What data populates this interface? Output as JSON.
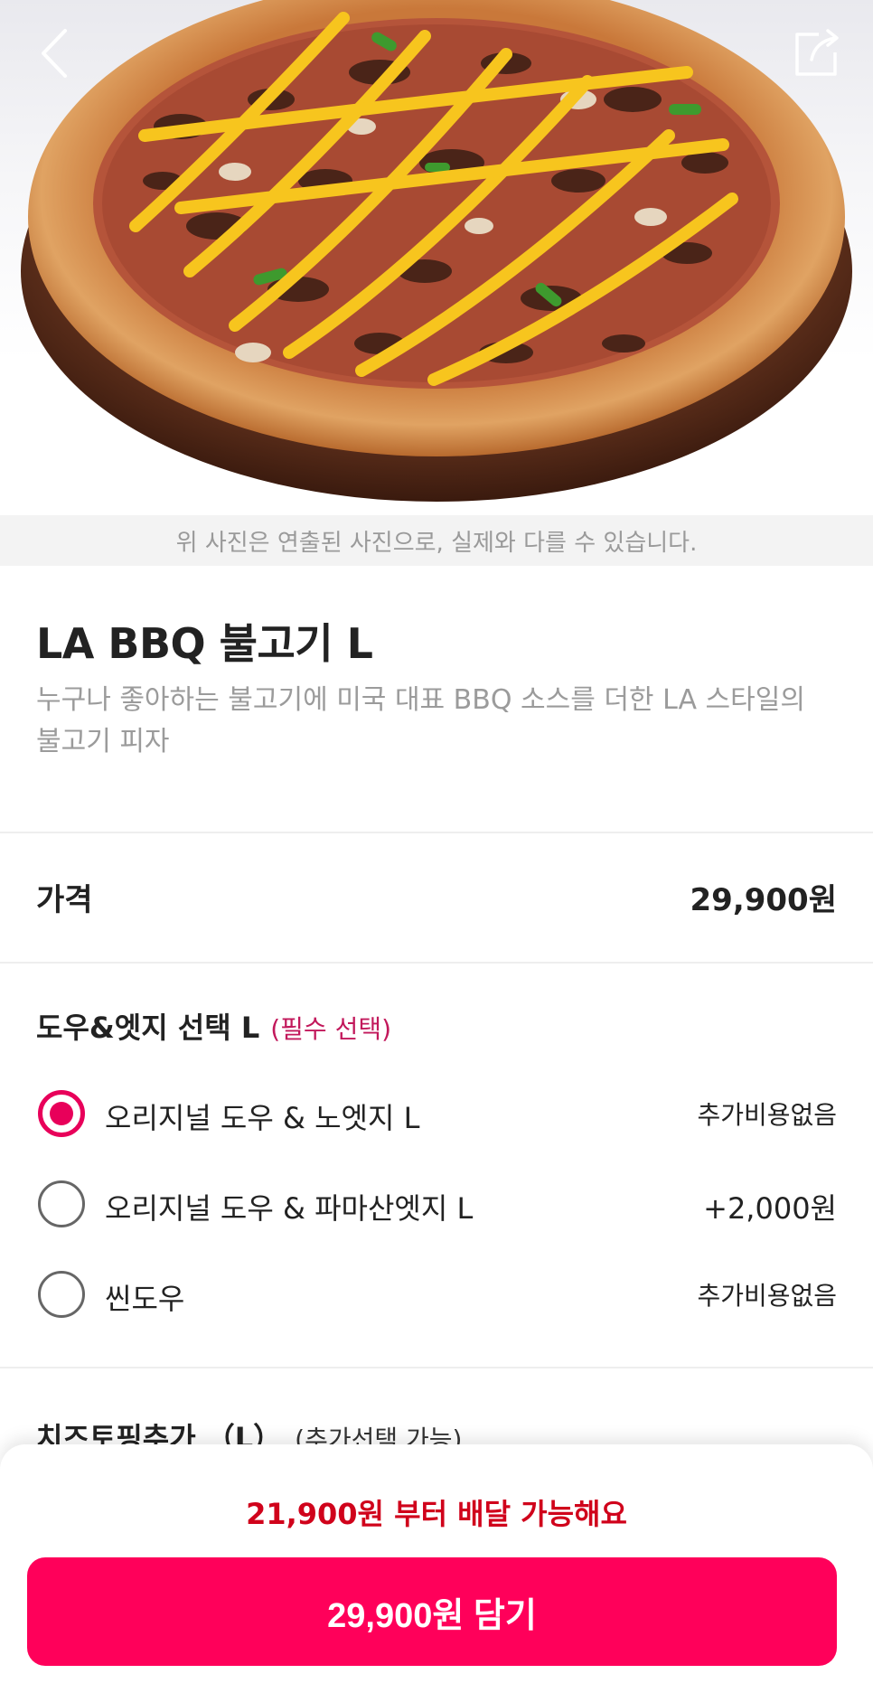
{
  "header": {
    "back_icon": "chevron-left-icon",
    "share_icon": "share-icon"
  },
  "image": {
    "disclaimer": "위 사진은 연출된 사진으로, 실제와 다를 수 있습니다."
  },
  "product": {
    "name": "LA BBQ 불고기 L",
    "description": "누구나 좋아하는 불고기에 미국 대표 BBQ 소스를 더한 LA 스타일의 불고기 피자"
  },
  "price": {
    "label": "가격",
    "value": "29,900원"
  },
  "dough_section": {
    "title": "도우&엣지 선택 L",
    "required": "(필수 선택)",
    "options": [
      {
        "label": "오리지널 도우 & 노엣지 L",
        "price": "추가비용없음",
        "selected": true
      },
      {
        "label": "오리지널 도우 & 파마산엣지 L",
        "price": "+2,000원",
        "selected": false
      },
      {
        "label": "씬도우",
        "price": "추가비용없음",
        "selected": false
      }
    ]
  },
  "cheese_section": {
    "title": "치즈토핑추가 （L）",
    "note": "(추가선택 가능)"
  },
  "footer": {
    "min_order": "21,900원 부터 배달 가능해요",
    "add_button": "29,900원 담기"
  },
  "colors": {
    "accent": "#ff005a",
    "radio_selected": "#e8005a",
    "required_text": "#c2185b",
    "min_order_text": "#d0021b"
  }
}
